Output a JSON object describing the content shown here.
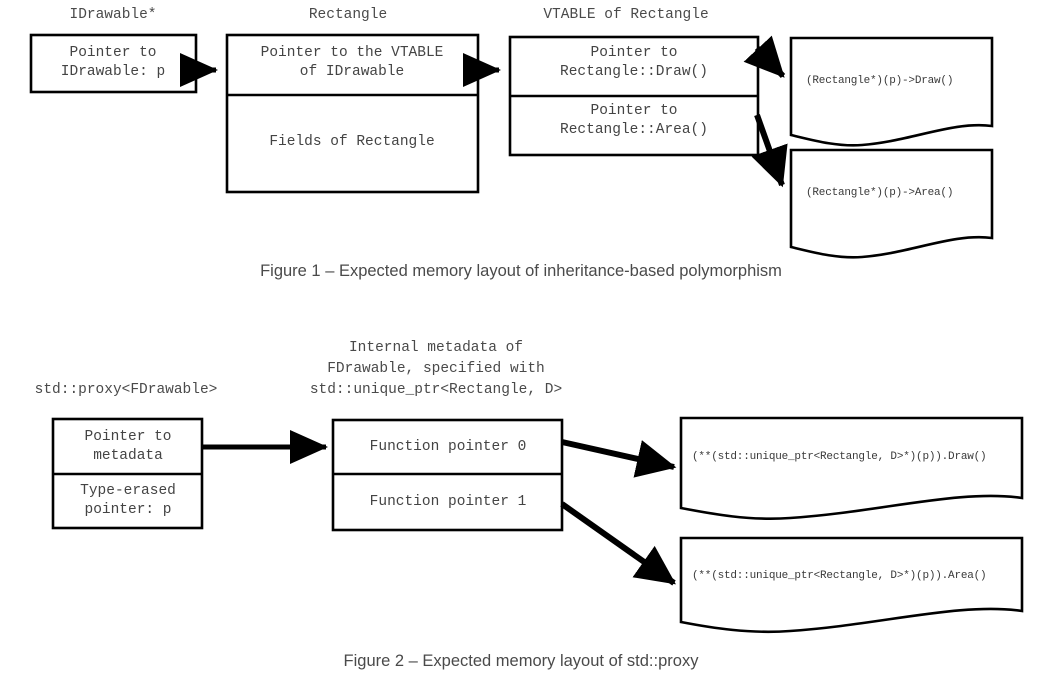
{
  "figure1": {
    "headers": {
      "left": "IDrawable*",
      "middle": "Rectangle",
      "right": "VTABLE of Rectangle"
    },
    "idrawable_box": {
      "line1": "Pointer to",
      "line2": "IDrawable: p"
    },
    "rectangle_box": {
      "slot1_line1": "Pointer to the VTABLE",
      "slot1_line2": "of IDrawable",
      "slot2": "Fields of Rectangle"
    },
    "vtable_box": {
      "slot1_line1": "Pointer to",
      "slot1_line2": "Rectangle::Draw()",
      "slot2_line1": "Pointer to",
      "slot2_line2": "Rectangle::Area()"
    },
    "notes": [
      "(Rectangle*)(p)->Draw()",
      "(Rectangle*)(p)->Area()"
    ],
    "caption": "Figure 1 – Expected memory layout of inheritance-based polymorphism"
  },
  "figure2": {
    "headers": {
      "left": "std::proxy<FDrawable>",
      "middle_line1": "Internal metadata of",
      "middle_line2": "FDrawable, specified with",
      "middle_line3": "std::unique_ptr<Rectangle, D>"
    },
    "proxy_box": {
      "slot1_line1": "Pointer to",
      "slot1_line2": "metadata",
      "slot2_line1": "Type-erased",
      "slot2_line2": "pointer: p"
    },
    "metadata_box": {
      "slot1": "Function pointer 0",
      "slot2": "Function pointer 1"
    },
    "notes": [
      "(**(std::unique_ptr<Rectangle, D>*)(p)).Draw()",
      "(**(std::unique_ptr<Rectangle, D>*)(p)).Area()"
    ],
    "caption": "Figure 2 – Expected memory layout of std::proxy"
  },
  "colors": {
    "stroke": "#000000",
    "text": "#444444",
    "caption": "#4a4a4a",
    "background": "#ffffff"
  }
}
